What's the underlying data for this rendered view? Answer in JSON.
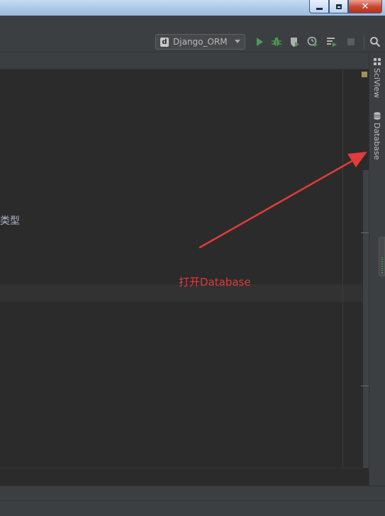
{
  "toolbar": {
    "run_configuration": "Django_ORM",
    "run_config_icon": "django-icon",
    "icons": [
      "run-icon",
      "debug-icon",
      "coverage-icon",
      "profile-icon",
      "concurrency-icon",
      "stop-icon",
      "search-icon"
    ]
  },
  "editor": {
    "visible_text": "类型"
  },
  "right_tool_windows": [
    {
      "label": "SciView",
      "icon": "grid-icon"
    },
    {
      "label": "Database",
      "icon": "database-icon"
    }
  ],
  "annotation": {
    "text": "打开Database",
    "color": "#e23b3b"
  },
  "colors": {
    "run_green": "#499c54",
    "editor_bg": "#2b2b2b",
    "panel_bg": "#3c3f41"
  }
}
